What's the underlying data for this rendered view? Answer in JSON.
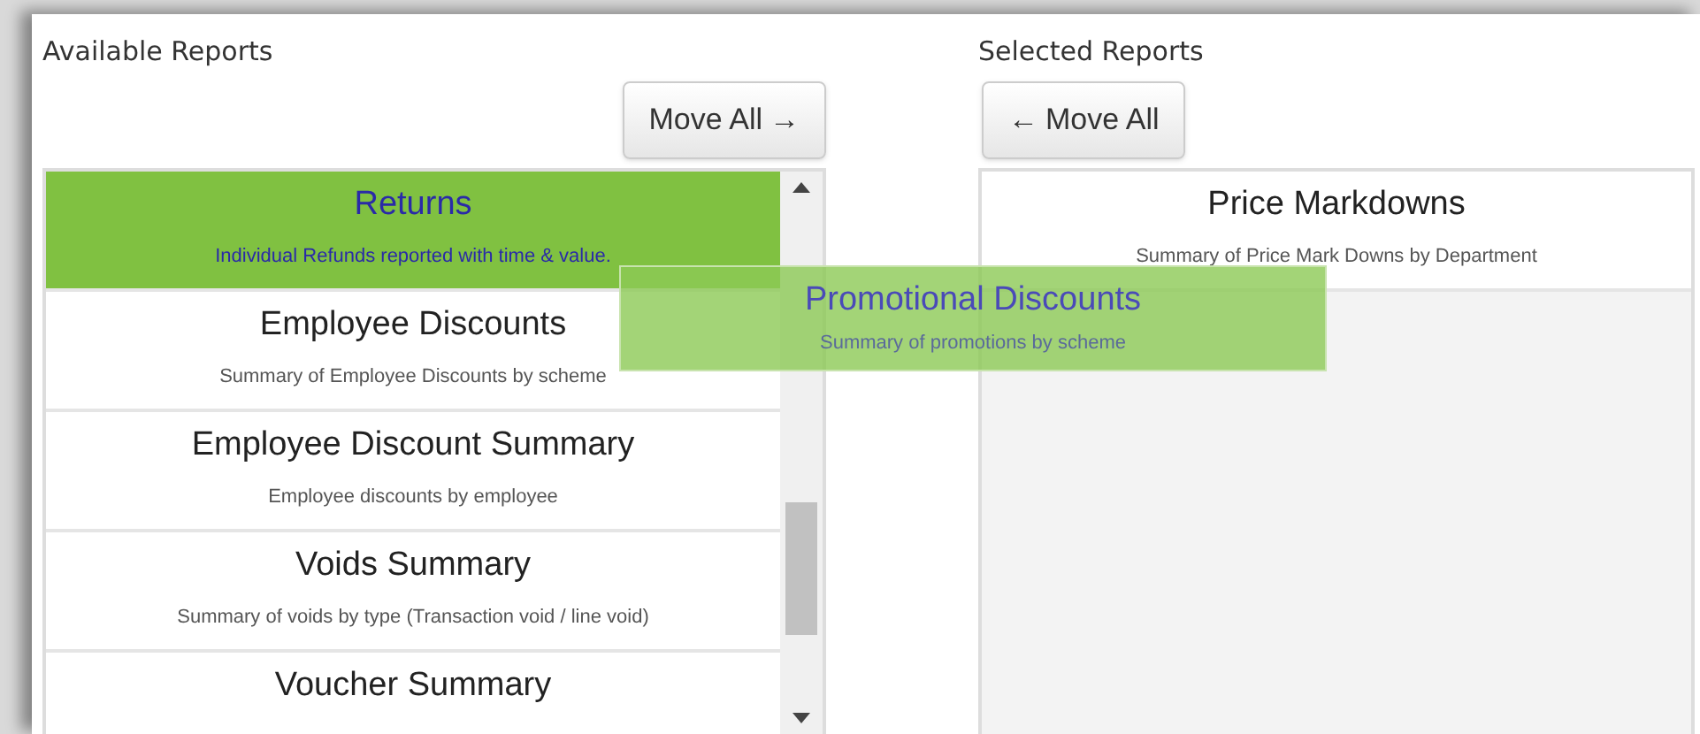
{
  "available": {
    "title": "Available Reports",
    "move_all": {
      "label": "Move All",
      "arrow": "→"
    },
    "items": [
      {
        "title": "Returns",
        "description": "Individual Refunds reported with time & value.",
        "selected": true
      },
      {
        "title": "Employee Discounts",
        "description": "Summary of Employee Discounts by scheme",
        "selected": false
      },
      {
        "title": "Employee Discount Summary",
        "description": "Employee discounts by employee",
        "selected": false
      },
      {
        "title": "Voids Summary",
        "description": "Summary of voids by type (Transaction void / line void)",
        "selected": false
      },
      {
        "title": "Voucher Summary",
        "selected": false
      }
    ]
  },
  "dragging": {
    "title": "Promotional Discounts",
    "description": "Summary of promotions by scheme"
  },
  "selected": {
    "title": "Selected Reports",
    "move_all": {
      "label": "Move All",
      "arrow": "←"
    },
    "items": [
      {
        "title": "Price Markdowns",
        "description": "Summary of Price Mark Downs by Department",
        "selected": false
      }
    ]
  }
}
